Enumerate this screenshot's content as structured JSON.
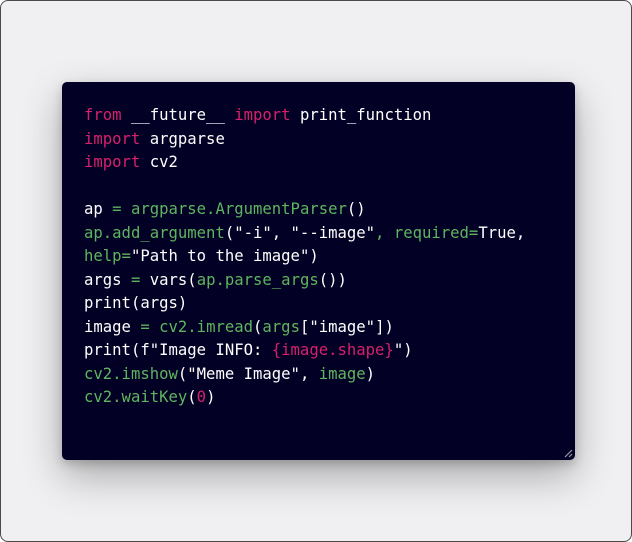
{
  "code_lines": [
    [
      {
        "t": "from",
        "c": "kw"
      },
      {
        "t": " __future__ ",
        "c": ""
      },
      {
        "t": "import",
        "c": "kw"
      },
      {
        "t": " print_function",
        "c": ""
      }
    ],
    [
      {
        "t": "import",
        "c": "kw"
      },
      {
        "t": " argparse",
        "c": ""
      }
    ],
    [
      {
        "t": "import",
        "c": "kw"
      },
      {
        "t": " cv2",
        "c": ""
      }
    ],
    [],
    [
      {
        "t": "ap",
        "c": ""
      },
      {
        "t": " = ",
        "c": "fn"
      },
      {
        "t": "argparse.ArgumentParser",
        "c": "fn"
      },
      {
        "t": "()",
        "c": ""
      }
    ],
    [
      {
        "t": "ap.add_argument",
        "c": "fn"
      },
      {
        "t": "(\"-i\", \"--image\"",
        "c": ""
      },
      {
        "t": ", required=",
        "c": "fn"
      },
      {
        "t": "True,",
        "c": ""
      }
    ],
    [
      {
        "t": "help=",
        "c": "fn"
      },
      {
        "t": "\"Path to the image\")",
        "c": ""
      }
    ],
    [
      {
        "t": "args",
        "c": ""
      },
      {
        "t": " = ",
        "c": "fn"
      },
      {
        "t": "vars(",
        "c": ""
      },
      {
        "t": "ap.parse_args",
        "c": "fn"
      },
      {
        "t": "())",
        "c": ""
      }
    ],
    [
      {
        "t": "print(args)",
        "c": ""
      }
    ],
    [
      {
        "t": "image",
        "c": ""
      },
      {
        "t": " = ",
        "c": "fn"
      },
      {
        "t": "cv2.imread",
        "c": "fn"
      },
      {
        "t": "(",
        "c": ""
      },
      {
        "t": "args",
        "c": "fn"
      },
      {
        "t": "[\"image\"])",
        "c": ""
      }
    ],
    [
      {
        "t": "print(f\"Image INFO: ",
        "c": ""
      },
      {
        "t": "{image.shape}",
        "c": "kw"
      },
      {
        "t": "\")",
        "c": ""
      }
    ],
    [
      {
        "t": "cv2.imshow",
        "c": "fn"
      },
      {
        "t": "(\"Meme Image\", ",
        "c": ""
      },
      {
        "t": "image",
        "c": "fn"
      },
      {
        "t": ")",
        "c": ""
      }
    ],
    [
      {
        "t": "cv2.waitKey",
        "c": "fn"
      },
      {
        "t": "(",
        "c": ""
      },
      {
        "t": "0",
        "c": "num"
      },
      {
        "t": ")",
        "c": ""
      }
    ]
  ],
  "colors": {
    "editor_bg": "#020025",
    "keyword": "#d6216a",
    "identifier": "#5fb55f",
    "text": "#ffffff"
  },
  "icons": {
    "resize": "resize-handle-icon"
  }
}
